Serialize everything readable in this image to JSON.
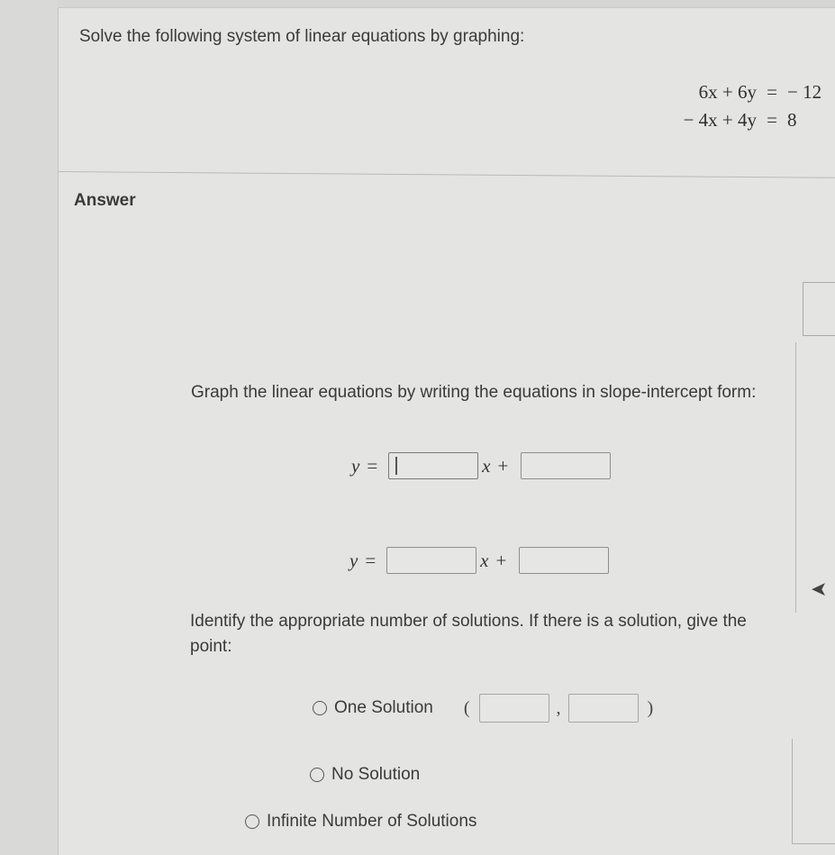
{
  "question": {
    "prompt": "Solve the following system of linear equations by graphing:",
    "equations": [
      {
        "lhs": "6x + 6y",
        "op": "=",
        "rhs": "− 12"
      },
      {
        "lhs": "− 4x + 4y",
        "op": "=",
        "rhs": "8"
      }
    ]
  },
  "answer": {
    "label": "Answer",
    "instruction": "Graph the linear equations by writing the equations in slope-intercept form:",
    "slope_intercept_rows": [
      {
        "y_label": "y",
        "equals": "=",
        "x_var": "x",
        "plus": "+",
        "slope_value": "",
        "intercept_value": "",
        "slope_focused": true
      },
      {
        "y_label": "y",
        "equals": "=",
        "x_var": "x",
        "plus": "+",
        "slope_value": "",
        "intercept_value": "",
        "slope_focused": false
      }
    ],
    "identify_text": "Identify the appropriate number of solutions. If there is a solution, give the point:",
    "options": [
      {
        "label": "One Solution",
        "selected": false
      },
      {
        "label": "No Solution",
        "selected": false
      },
      {
        "label": "Infinite Number of Solutions",
        "selected": false
      }
    ],
    "point": {
      "open_paren": "(",
      "comma": ",",
      "close_paren": ")",
      "x_value": "",
      "y_value": ""
    }
  },
  "edge": {
    "arrow_icon": "back-arrow-icon"
  }
}
